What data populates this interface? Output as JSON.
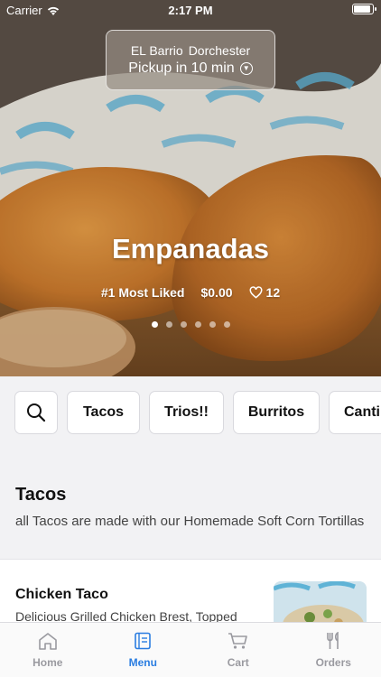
{
  "status_bar": {
    "carrier": "Carrier",
    "time": "2:17 PM"
  },
  "location": {
    "store": "EL Barrio",
    "area": "Dorchester",
    "pickup": "Pickup in 10 min",
    "icon": "chevron-down-circle-icon"
  },
  "hero": {
    "title": "Empanadas",
    "badge": "#1 Most Liked",
    "price": "$0.00",
    "likes": "12",
    "carousel_count": 6,
    "carousel_active": 0
  },
  "categories": [
    "Tacos",
    "Trios!!",
    "Burritos",
    "Cantina"
  ],
  "section": {
    "title": "Tacos",
    "description": "all Tacos are made with our Homemade Soft Corn Tortillas"
  },
  "items": [
    {
      "name": "Chicken Taco",
      "description": "Delicious Grilled Chicken Brest, Topped"
    }
  ],
  "tabs": [
    {
      "label": "Home",
      "icon": "home-icon"
    },
    {
      "label": "Menu",
      "icon": "menu-book-icon"
    },
    {
      "label": "Cart",
      "icon": "cart-icon"
    },
    {
      "label": "Orders",
      "icon": "fork-knife-icon"
    }
  ],
  "active_tab": "Menu",
  "colors": {
    "accent": "#2a7de1",
    "inactive": "#9a9aa0"
  }
}
